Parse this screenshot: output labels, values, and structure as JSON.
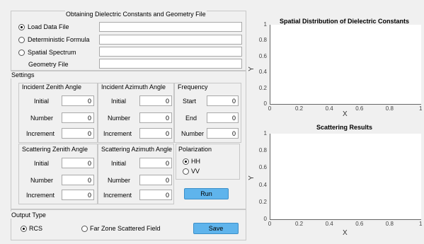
{
  "geometry_panel": {
    "title": "Obtaining Dielectric Constants and Geometry File",
    "options": [
      {
        "label": "Load Data File",
        "selected": true,
        "value": ""
      },
      {
        "label": "Deterministic Formula",
        "selected": false,
        "value": ""
      },
      {
        "label": "Spatial Spectrum",
        "selected": false,
        "value": ""
      }
    ],
    "geometry_file_label": "Geometry File",
    "geometry_file_value": ""
  },
  "settings": {
    "title": "Settings",
    "incident_zenith": {
      "title": "Incident Zenith Angle",
      "initial_label": "Initial",
      "initial": "0",
      "number_label": "Number",
      "number": "0",
      "increment_label": "Increment",
      "increment": "0"
    },
    "incident_azimuth": {
      "title": "Incident Azimuth Angle",
      "initial_label": "Initial",
      "initial": "0",
      "number_label": "Number",
      "number": "0",
      "increment_label": "Increment",
      "increment": "0"
    },
    "frequency": {
      "title": "Frequency",
      "start_label": "Start",
      "start": "0",
      "end_label": "End",
      "end": "0",
      "number_label": "Number",
      "number": "0"
    },
    "scattering_zenith": {
      "title": "Scattering Zenith Angle",
      "initial_label": "Initial",
      "initial": "0",
      "number_label": "Number",
      "number": "0",
      "increment_label": "Increment",
      "increment": "0"
    },
    "scattering_azimuth": {
      "title": "Scattering Azimuth Angle",
      "initial_label": "Initial",
      "initial": "0",
      "number_label": "Number",
      "number": "0",
      "increment_label": "Increment",
      "increment": "0"
    },
    "polarization": {
      "title": "Polarization",
      "hh_label": "HH",
      "vv_label": "VV",
      "selected": "HH"
    },
    "run_label": "Run"
  },
  "output": {
    "title": "Output Type",
    "rcs_label": "RCS",
    "far_zone_label": "Far Zone Scattered Field",
    "selected": "RCS",
    "save_label": "Save"
  },
  "chart_data": [
    {
      "type": "scatter",
      "title": "Spatial Distribution of Dielectric Constants",
      "xlabel": "X",
      "ylabel": "Y",
      "xlim": [
        0,
        1
      ],
      "ylim": [
        0,
        1
      ],
      "xticks": [
        "0",
        "0.2",
        "0.4",
        "0.6",
        "0.8",
        "1"
      ],
      "yticks": [
        "0",
        "0.2",
        "0.4",
        "0.6",
        "0.8",
        "1"
      ],
      "series": []
    },
    {
      "type": "scatter",
      "title": "Scattering Results",
      "xlabel": "X",
      "ylabel": "Y",
      "xlim": [
        0,
        1
      ],
      "ylim": [
        0,
        1
      ],
      "xticks": [
        "0",
        "0.2",
        "0.4",
        "0.6",
        "0.8",
        "1"
      ],
      "yticks": [
        "0",
        "0.2",
        "0.4",
        "0.6",
        "0.8",
        "1"
      ],
      "series": []
    }
  ],
  "colors": {
    "button": "#5fb4ec",
    "background": "#f0f0f0",
    "axes_bg": "#ffffff"
  }
}
